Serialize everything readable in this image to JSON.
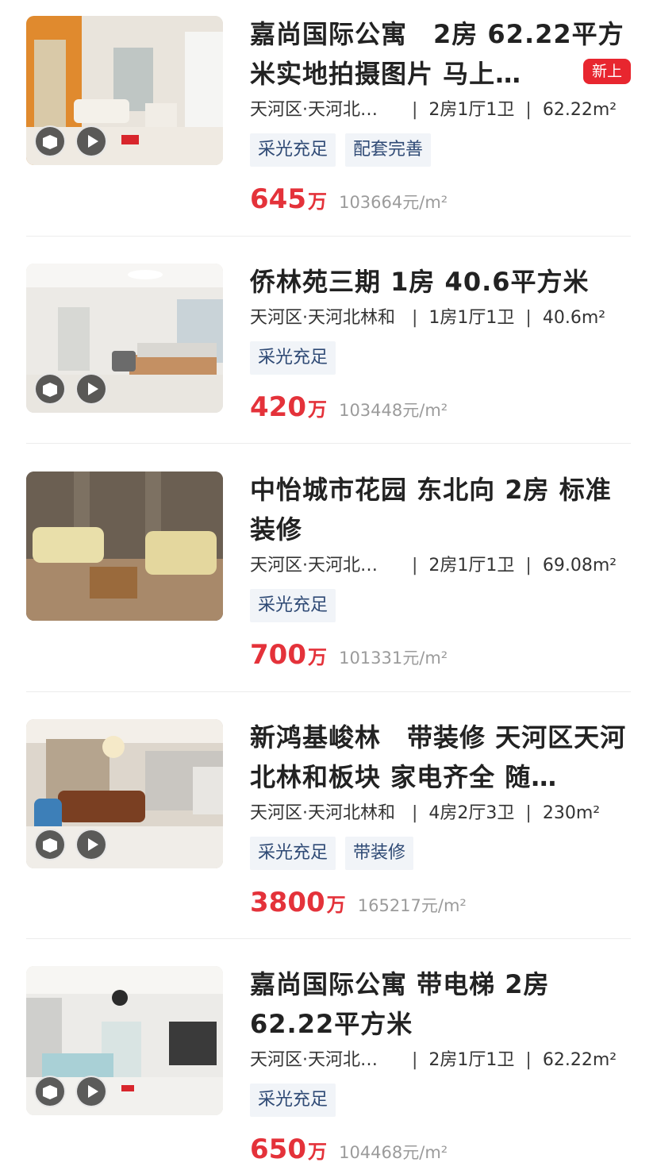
{
  "colors": {
    "price": "#e4323a",
    "tag_bg": "#f1f4f8",
    "tag_text": "#2f4a75",
    "new_badge": "#e8262f"
  },
  "listings": [
    {
      "title": "嘉尚国际公寓　2房 62.22平方米实地拍摄图片 马上…",
      "badge": "新上",
      "location": "天河区·天河北…",
      "layout": "2房1厅1卫",
      "area": "62.22m²",
      "tags": [
        "采光充足",
        "配套完善"
      ],
      "price": "645",
      "price_unit": "万",
      "unit_price": "103664元/m²",
      "photo": "living-room-orange-wall",
      "has_vr": true,
      "has_video": true
    },
    {
      "title": "侨林苑三期 1房 40.6平方米",
      "location": "天河区·天河北林和",
      "layout": "1房1厅1卫",
      "area": "40.6m²",
      "tags": [
        "采光充足"
      ],
      "price": "420",
      "price_unit": "万",
      "unit_price": "103448元/m²",
      "photo": "studio-with-bed",
      "has_vr": true,
      "has_video": true
    },
    {
      "title": "中怡城市花园 东北向 2房 标准装修",
      "location": "天河区·天河北…",
      "layout": "2房1厅1卫",
      "area": "69.08m²",
      "tags": [
        "采光充足"
      ],
      "price": "700",
      "price_unit": "万",
      "unit_price": "101331元/m²",
      "photo": "living-room-sofas",
      "has_vr": false,
      "has_video": false
    },
    {
      "title": "新鸿基峻林　带装修 天河区天河北林和板块 家电齐全 随…",
      "location": "天河区·天河北林和",
      "layout": "4房2厅3卫",
      "area": "230m²",
      "tags": [
        "采光充足",
        "带装修"
      ],
      "price": "3800",
      "price_unit": "万",
      "unit_price": "165217元/m²",
      "photo": "luxury-living-room",
      "has_vr": true,
      "has_video": true
    },
    {
      "title": "嘉尚国际公寓 带电梯 2房 62.22平方米",
      "location": "天河区·天河北…",
      "layout": "2房1厅1卫",
      "area": "62.22m²",
      "tags": [
        "采光充足"
      ],
      "price": "650",
      "price_unit": "万",
      "unit_price": "104468元/m²",
      "photo": "bright-living-room",
      "has_vr": true,
      "has_video": true
    }
  ]
}
